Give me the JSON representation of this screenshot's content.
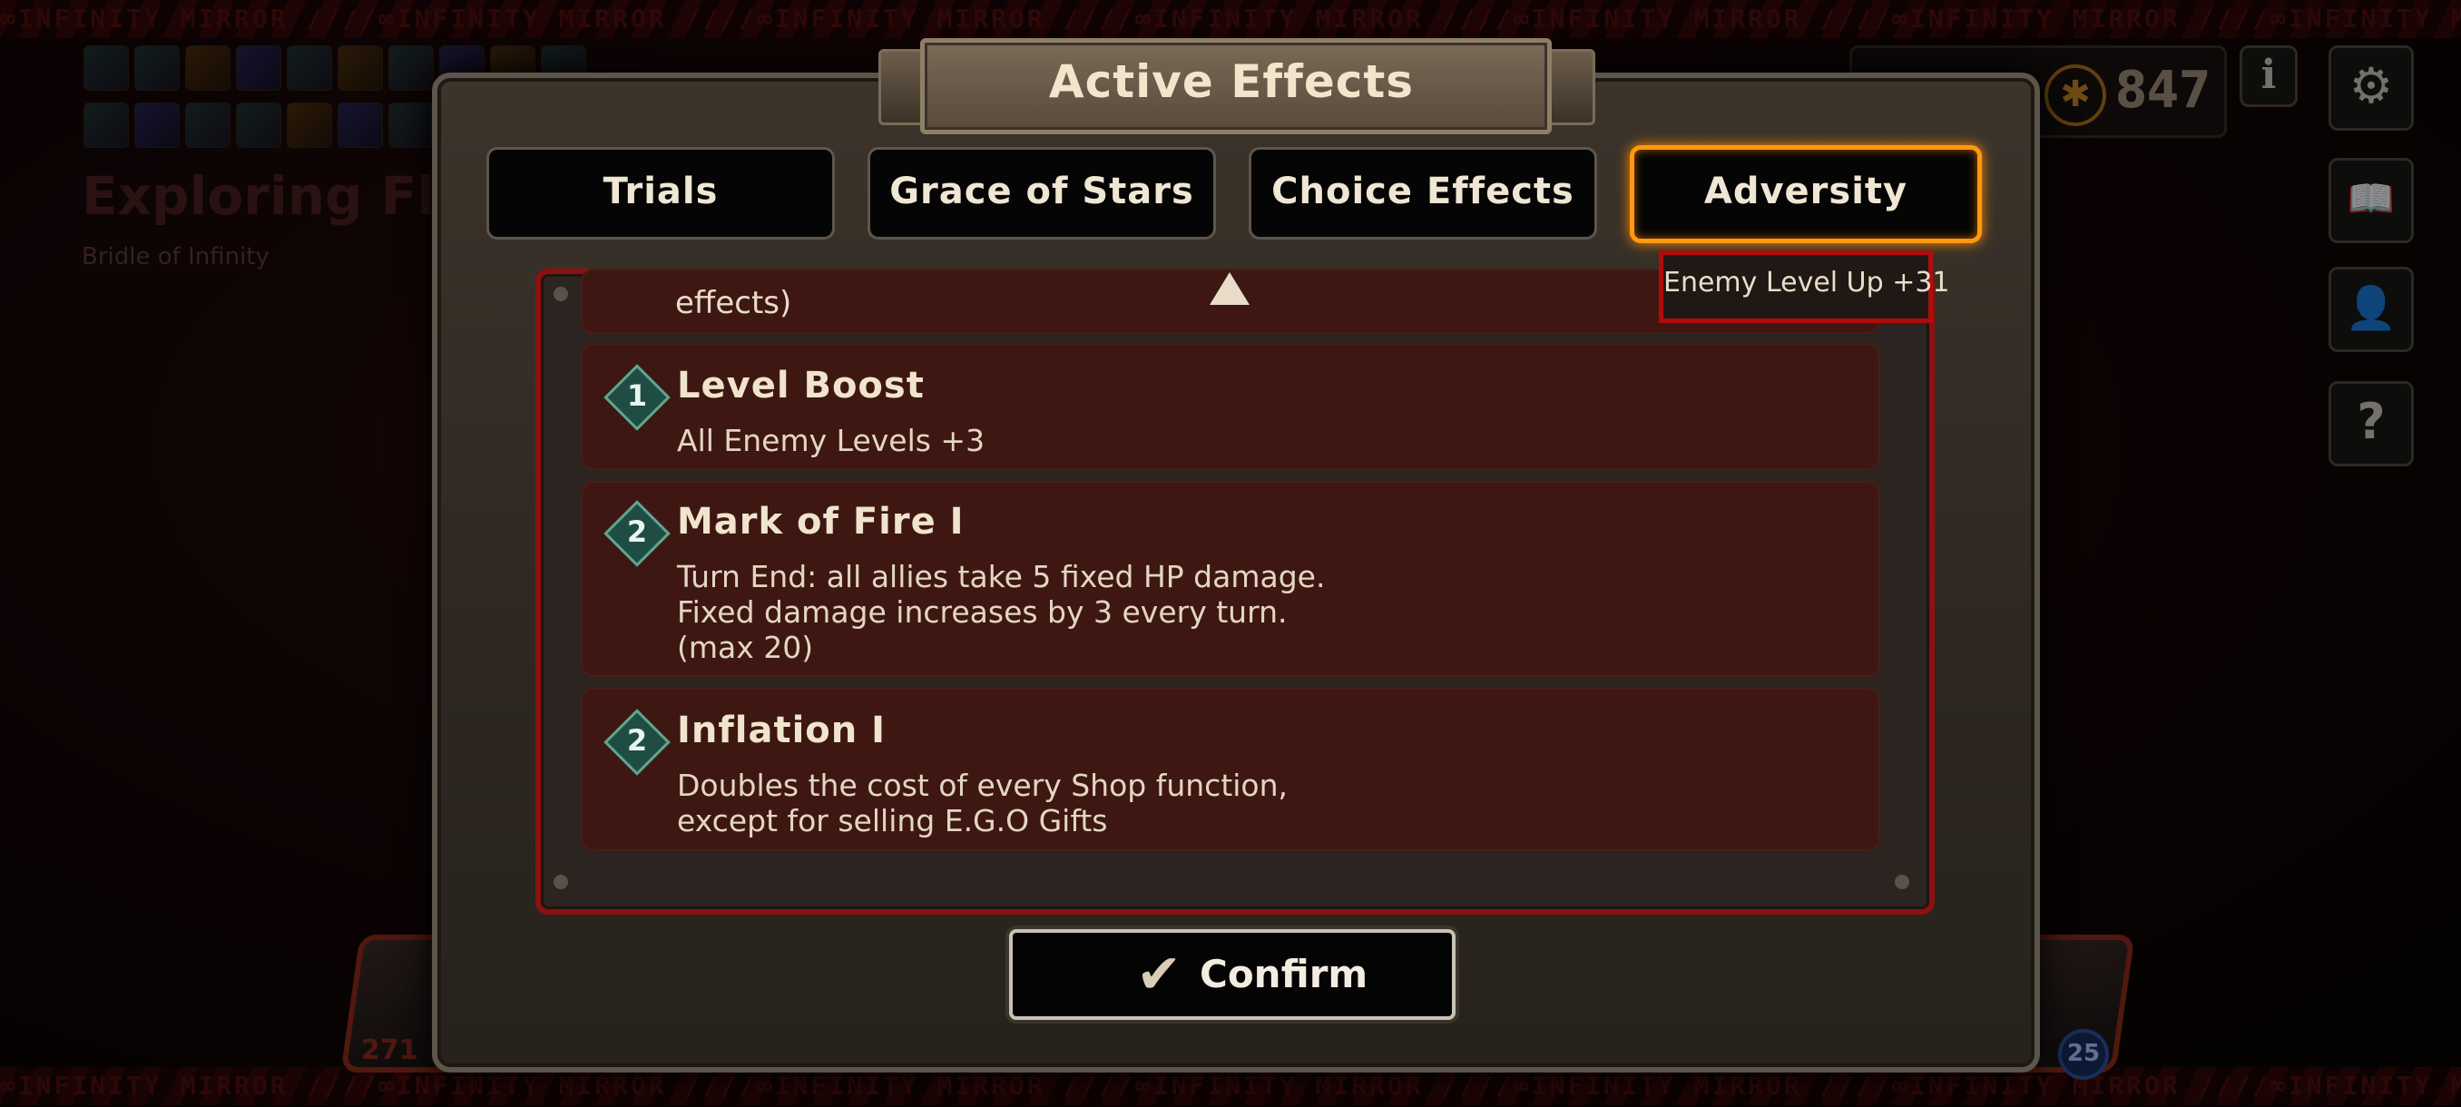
{
  "banner": {
    "top_text": "∞INFINITY MIRROR ////∞INFINITY MIRROR ////∞INFINITY MIRROR ////∞INFINITY MIRROR ////∞INFINITY MIRROR ////∞INFINITY MIRROR ////∞INFINITY MIRROR ////",
    "bottom_text": "∞INFINITY MIRROR ////∞INFINITY MIRROR ////∞INFINITY MIRROR ////∞INFINITY MIRROR ////∞INFINITY MIRROR ////∞INFINITY MIRROR ////∞INFINITY MIRROR ////"
  },
  "background": {
    "explore_title": "Exploring Floo",
    "explore_subtitle": "Bridle of Infinity",
    "currency_value": "847",
    "left_unit_value": "271",
    "right_unit_level": "25"
  },
  "dialog": {
    "title": "Active Effects",
    "tabs": [
      {
        "label": "Trials",
        "active": false
      },
      {
        "label": "Grace of Stars",
        "active": false
      },
      {
        "label": "Choice Effects",
        "active": false
      },
      {
        "label": "Adversity",
        "active": true
      }
    ],
    "enemy_level_up": "Enemy Level Up +31",
    "partial_text": "effects)",
    "effects": [
      {
        "tier": "1",
        "title": "Level Boost",
        "desc": "All Enemy Levels +3"
      },
      {
        "tier": "2",
        "title": "Mark of Fire I",
        "desc": "Turn End: all allies take 5 fixed HP damage. Fixed damage increases by 3 every turn. (max 20)"
      },
      {
        "tier": "2",
        "title": "Inflation I",
        "desc": "Doubles the cost of every Shop function, except for selling E.G.O Gifts"
      }
    ],
    "confirm_label": "Confirm"
  },
  "colors": {
    "accent_tab": "#ff9a10",
    "frame_red": "#8e1010",
    "card_bg": "#3e1712"
  }
}
